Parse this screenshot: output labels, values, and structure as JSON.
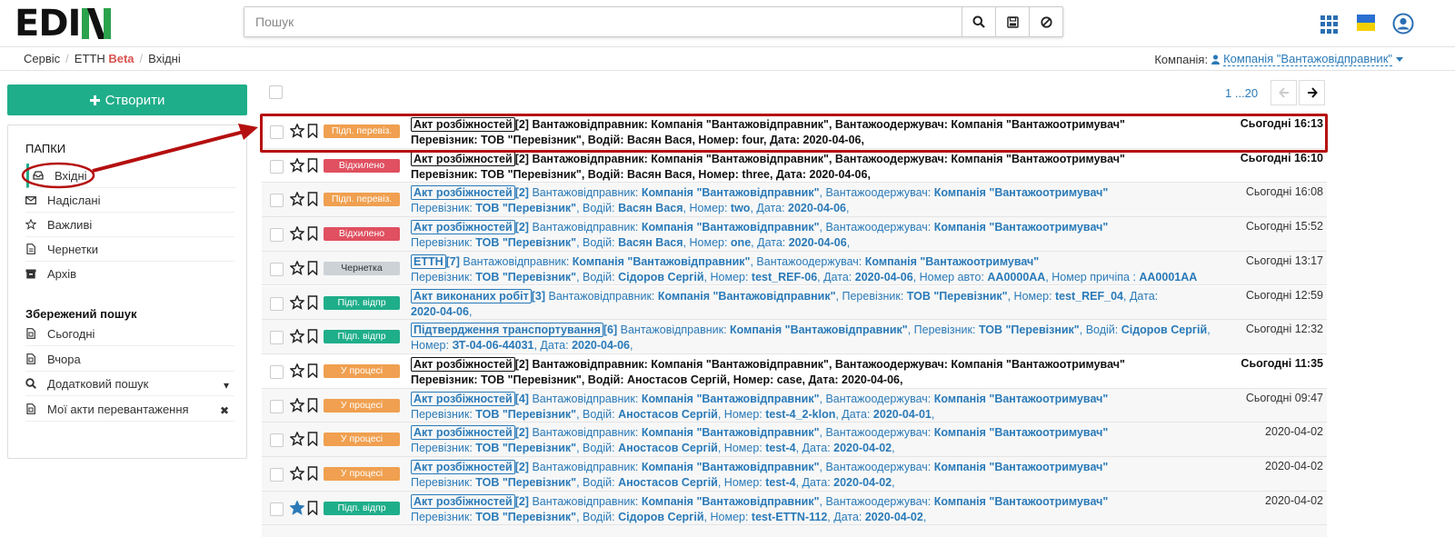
{
  "header": {
    "logo": "EDI",
    "search": {
      "placeholder": "Пошук",
      "value": ""
    },
    "buttons": [
      "search-icon",
      "save-icon",
      "clear-icon"
    ],
    "right_icons": [
      "apps-grid-icon",
      "ua-flag-icon",
      "user-icon"
    ],
    "colors": {
      "brand_green": "#2ba24c",
      "accent_blue": "#2a7ab8",
      "create_green": "#1fae8a"
    }
  },
  "breadcrumb": {
    "items": [
      "Сервіс",
      "ЕТТН",
      "Вхідні"
    ],
    "beta": "Beta",
    "separator": "/"
  },
  "company": {
    "label": "Компанія:",
    "name": "Компанія \"Вантажовідправник\""
  },
  "sidebar": {
    "create_label": "Створити",
    "folders_title": "ПАПКИ",
    "folders": [
      {
        "label": "Вхідні",
        "icon": "inbox-icon",
        "active": true
      },
      {
        "label": "Надіслані",
        "icon": "envelope-icon"
      },
      {
        "label": "Важливі",
        "icon": "star-icon"
      },
      {
        "label": "Чернетки",
        "icon": "file-icon"
      },
      {
        "label": "Архів",
        "icon": "archive-icon"
      }
    ],
    "saved_title": "Збережений пошук",
    "saved": [
      {
        "label": "Сьогодні",
        "icon": "doc-icon"
      },
      {
        "label": "Вчора",
        "icon": "doc-icon"
      },
      {
        "label": "Додатковий пошук",
        "icon": "search-icon",
        "right": "▾"
      },
      {
        "label": "Мої акти перевантаження",
        "icon": "doc-icon",
        "right": "✖"
      }
    ]
  },
  "pager": {
    "label": "1 ...20"
  },
  "status_colors": {
    "orange": "#f0a050",
    "red": "#e05060",
    "grey": "#ccd2d6",
    "green": "#1fae8a"
  },
  "rows": [
    {
      "status": "Підп. перевіз.",
      "color": "orange",
      "unread": true,
      "starred": false,
      "date": "Сьогодні 16:13",
      "doc": "Акт розбіжностей",
      "count": "[2]",
      "line1": [
        [
          "t",
          " Вантажовідправник: "
        ],
        [
          "b",
          "Компанія \"Вантажовідправник\""
        ],
        [
          "t",
          ", Вантажоодержувач: "
        ],
        [
          "b",
          "Компанія \"Вантажоотримувач\""
        ]
      ],
      "line2": [
        [
          "t",
          "Перевізник: "
        ],
        [
          "b",
          "ТОВ \"Перевізник\""
        ],
        [
          "t",
          ", Водій: "
        ],
        [
          "b",
          "Васян Вася"
        ],
        [
          "t",
          ", Номер: "
        ],
        [
          "b",
          "four"
        ],
        [
          "t",
          ", Дата: "
        ],
        [
          "b",
          "2020-04-06"
        ],
        [
          "t",
          ","
        ]
      ]
    },
    {
      "status": "Відхилено",
      "color": "red",
      "unread": true,
      "starred": false,
      "date": "Сьогодні 16:10",
      "doc": "Акт розбіжностей",
      "count": "[2]",
      "line1": [
        [
          "t",
          " Вантажовідправник: "
        ],
        [
          "b",
          "Компанія \"Вантажовідправник\""
        ],
        [
          "t",
          ", Вантажоодержувач: "
        ],
        [
          "b",
          "Компанія \"Вантажоотримувач\""
        ]
      ],
      "line2": [
        [
          "t",
          "Перевізник: "
        ],
        [
          "b",
          "ТОВ \"Перевізник\""
        ],
        [
          "t",
          ", Водій: "
        ],
        [
          "b",
          "Васян Вася"
        ],
        [
          "t",
          ", Номер: "
        ],
        [
          "b",
          "three"
        ],
        [
          "t",
          ", Дата: "
        ],
        [
          "b",
          "2020-04-06"
        ],
        [
          "t",
          ","
        ]
      ]
    },
    {
      "status": "Підп. перевіз.",
      "color": "orange",
      "unread": false,
      "starred": false,
      "date": "Сьогодні 16:08",
      "doc": "Акт розбіжностей",
      "count": "[2]",
      "line1": [
        [
          "t",
          " Вантажовідправник: "
        ],
        [
          "b",
          "Компанія \"Вантажовідправник\""
        ],
        [
          "t",
          ", Вантажоодержувач: "
        ],
        [
          "b",
          "Компанія \"Вантажоотримувач\""
        ]
      ],
      "line2": [
        [
          "t",
          "Перевізник: "
        ],
        [
          "b",
          "ТОВ \"Перевізник\""
        ],
        [
          "t",
          ", Водій: "
        ],
        [
          "b",
          "Васян Вася"
        ],
        [
          "t",
          ", Номер: "
        ],
        [
          "b",
          "two"
        ],
        [
          "t",
          ", Дата: "
        ],
        [
          "b",
          "2020-04-06"
        ],
        [
          "t",
          ","
        ]
      ]
    },
    {
      "status": "Відхилено",
      "color": "red",
      "unread": false,
      "starred": false,
      "date": "Сьогодні 15:52",
      "doc": "Акт розбіжностей",
      "count": "[2]",
      "line1": [
        [
          "t",
          " Вантажовідправник: "
        ],
        [
          "b",
          "Компанія \"Вантажовідправник\""
        ],
        [
          "t",
          ", Вантажоодержувач: "
        ],
        [
          "b",
          "Компанія \"Вантажоотримувач\""
        ]
      ],
      "line2": [
        [
          "t",
          "Перевізник: "
        ],
        [
          "b",
          "ТОВ \"Перевізник\""
        ],
        [
          "t",
          ", Водій: "
        ],
        [
          "b",
          "Васян Вася"
        ],
        [
          "t",
          ", Номер: "
        ],
        [
          "b",
          "one"
        ],
        [
          "t",
          ", Дата: "
        ],
        [
          "b",
          "2020-04-06"
        ],
        [
          "t",
          ","
        ]
      ]
    },
    {
      "status": "Чернетка",
      "color": "grey",
      "unread": false,
      "starred": false,
      "date": "Сьогодні 13:17",
      "doc": "ЕТТН",
      "count": "[7]",
      "line1": [
        [
          "t",
          " Вантажовідправник: "
        ],
        [
          "b",
          "Компанія \"Вантажовідправник\""
        ],
        [
          "t",
          ", Вантажоодержувач: "
        ],
        [
          "b",
          "Компанія \"Вантажоотримувач\""
        ]
      ],
      "line2": [
        [
          "t",
          "Перевізник: "
        ],
        [
          "b",
          "ТОВ \"Перевізник\""
        ],
        [
          "t",
          ", Водій: "
        ],
        [
          "b",
          "Сідоров Сергій"
        ],
        [
          "t",
          ", Номер: "
        ],
        [
          "b",
          "test_REF-06"
        ],
        [
          "t",
          ", Дата: "
        ],
        [
          "b",
          "2020-04-06"
        ],
        [
          "t",
          ", Номер авто: "
        ],
        [
          "b",
          "AA0000AA"
        ],
        [
          "t",
          ", Номер причіпа : "
        ],
        [
          "b",
          "AA0001AA"
        ]
      ]
    },
    {
      "status": "Підп. відпр",
      "color": "green",
      "unread": false,
      "starred": false,
      "date": "Сьогодні 12:59",
      "doc": "Акт виконаних робіт",
      "count": "[3]",
      "line1": [
        [
          "t",
          " Вантажовідправник: "
        ],
        [
          "b",
          "Компанія \"Вантажовідправник\""
        ],
        [
          "t",
          ", Перевізник: "
        ],
        [
          "b",
          "ТОВ \"Перевізник\""
        ],
        [
          "t",
          ", Номер: "
        ],
        [
          "b",
          "test_REF_04"
        ],
        [
          "t",
          ", Дата:"
        ]
      ],
      "line2": [
        [
          "b",
          "2020-04-06"
        ],
        [
          "t",
          ","
        ]
      ]
    },
    {
      "status": "Підп. відпр",
      "color": "green",
      "unread": false,
      "starred": false,
      "date": "Сьогодні 12:32",
      "doc": "Підтвердження транспортування",
      "count": "[6]",
      "line1": [
        [
          "t",
          " Вантажовідправник: "
        ],
        [
          "b",
          "Компанія \"Вантажовідправник\""
        ],
        [
          "t",
          ", Перевізник: "
        ],
        [
          "b",
          "ТОВ \"Перевізник\""
        ],
        [
          "t",
          ", Водій: "
        ],
        [
          "b",
          "Сідоров Сергій"
        ],
        [
          "t",
          ","
        ]
      ],
      "line2": [
        [
          "t",
          "Номер: "
        ],
        [
          "b",
          "ЗТ-04-06-44031"
        ],
        [
          "t",
          ", Дата: "
        ],
        [
          "b",
          "2020-04-06"
        ],
        [
          "t",
          ","
        ]
      ]
    },
    {
      "status": "У процесі",
      "color": "orange",
      "unread": true,
      "starred": false,
      "date": "Сьогодні 11:35",
      "doc": "Акт розбіжностей",
      "count": "[2]",
      "line1": [
        [
          "t",
          " Вантажовідправник: "
        ],
        [
          "b",
          "Компанія \"Вантажовідправник\""
        ],
        [
          "t",
          ", Вантажоодержувач: "
        ],
        [
          "b",
          "Компанія \"Вантажоотримувач\""
        ]
      ],
      "line2": [
        [
          "t",
          "Перевізник: "
        ],
        [
          "b",
          "ТОВ \"Перевізник\""
        ],
        [
          "t",
          ", Водій: "
        ],
        [
          "b",
          "Аностасов Сергій"
        ],
        [
          "t",
          ", Номер: "
        ],
        [
          "b",
          "case"
        ],
        [
          "t",
          ", Дата: "
        ],
        [
          "b",
          "2020-04-06"
        ],
        [
          "t",
          ","
        ]
      ]
    },
    {
      "status": "У процесі",
      "color": "orange",
      "unread": false,
      "starred": false,
      "date": "Сьогодні 09:47",
      "doc": "Акт розбіжностей",
      "count": "[4]",
      "line1": [
        [
          "t",
          " Вантажовідправник: "
        ],
        [
          "b",
          "Компанія \"Вантажовідправник\""
        ],
        [
          "t",
          ", Вантажоодержувач: "
        ],
        [
          "b",
          "Компанія \"Вантажоотримувач\""
        ]
      ],
      "line2": [
        [
          "t",
          "Перевізник: "
        ],
        [
          "b",
          "ТОВ \"Перевізник\""
        ],
        [
          "t",
          ", Водій: "
        ],
        [
          "b",
          "Аностасов Сергій"
        ],
        [
          "t",
          ", Номер: "
        ],
        [
          "b",
          "test-4_2-klon"
        ],
        [
          "t",
          ", Дата: "
        ],
        [
          "b",
          "2020-04-01"
        ],
        [
          "t",
          ","
        ]
      ]
    },
    {
      "status": "У процесі",
      "color": "orange",
      "unread": false,
      "starred": false,
      "date": "2020-04-02",
      "doc": "Акт розбіжностей",
      "count": "[2]",
      "line1": [
        [
          "t",
          " Вантажовідправник: "
        ],
        [
          "b",
          "Компанія \"Вантажовідправник\""
        ],
        [
          "t",
          ", Вантажоодержувач: "
        ],
        [
          "b",
          "Компанія \"Вантажоотримувач\""
        ]
      ],
      "line2": [
        [
          "t",
          "Перевізник: "
        ],
        [
          "b",
          "ТОВ \"Перевізник\""
        ],
        [
          "t",
          ", Водій: "
        ],
        [
          "b",
          "Аностасов Сергій"
        ],
        [
          "t",
          ", Номер: "
        ],
        [
          "b",
          "test-4"
        ],
        [
          "t",
          ", Дата: "
        ],
        [
          "b",
          "2020-04-02"
        ],
        [
          "t",
          ","
        ]
      ]
    },
    {
      "status": "У процесі",
      "color": "orange",
      "unread": false,
      "starred": false,
      "date": "2020-04-02",
      "doc": "Акт розбіжностей",
      "count": "[2]",
      "line1": [
        [
          "t",
          " Вантажовідправник: "
        ],
        [
          "b",
          "Компанія \"Вантажовідправник\""
        ],
        [
          "t",
          ", Вантажоодержувач: "
        ],
        [
          "b",
          "Компанія \"Вантажоотримувач\""
        ]
      ],
      "line2": [
        [
          "t",
          "Перевізник: "
        ],
        [
          "b",
          "ТОВ \"Перевізник\""
        ],
        [
          "t",
          ", Водій: "
        ],
        [
          "b",
          "Аностасов Сергій"
        ],
        [
          "t",
          ", Номер: "
        ],
        [
          "b",
          "test-4"
        ],
        [
          "t",
          ", Дата: "
        ],
        [
          "b",
          "2020-04-02"
        ],
        [
          "t",
          ","
        ]
      ]
    },
    {
      "status": "Підп. відпр",
      "color": "green",
      "unread": false,
      "starred": true,
      "date": "2020-04-02",
      "doc": "Акт розбіжностей",
      "count": "[2]",
      "line1": [
        [
          "t",
          " Вантажовідправник: "
        ],
        [
          "b",
          "Компанія \"Вантажовідправник\""
        ],
        [
          "t",
          ", Вантажоодержувач: "
        ],
        [
          "b",
          "Компанія \"Вантажоотримувач\""
        ]
      ],
      "line2": [
        [
          "t",
          "Перевізник: "
        ],
        [
          "b",
          "ТОВ \"Перевізник\""
        ],
        [
          "t",
          ", Водій: "
        ],
        [
          "b",
          "Сідоров Сергій"
        ],
        [
          "t",
          ", Номер: "
        ],
        [
          "b",
          "test-ETTN-112"
        ],
        [
          "t",
          ", Дата: "
        ],
        [
          "b",
          "2020-04-02"
        ],
        [
          "t",
          ","
        ]
      ]
    },
    {
      "status": "",
      "color": "green",
      "unread": false,
      "starred": false,
      "date": "",
      "doc": "",
      "count": "",
      "line1": [],
      "line2": []
    }
  ]
}
